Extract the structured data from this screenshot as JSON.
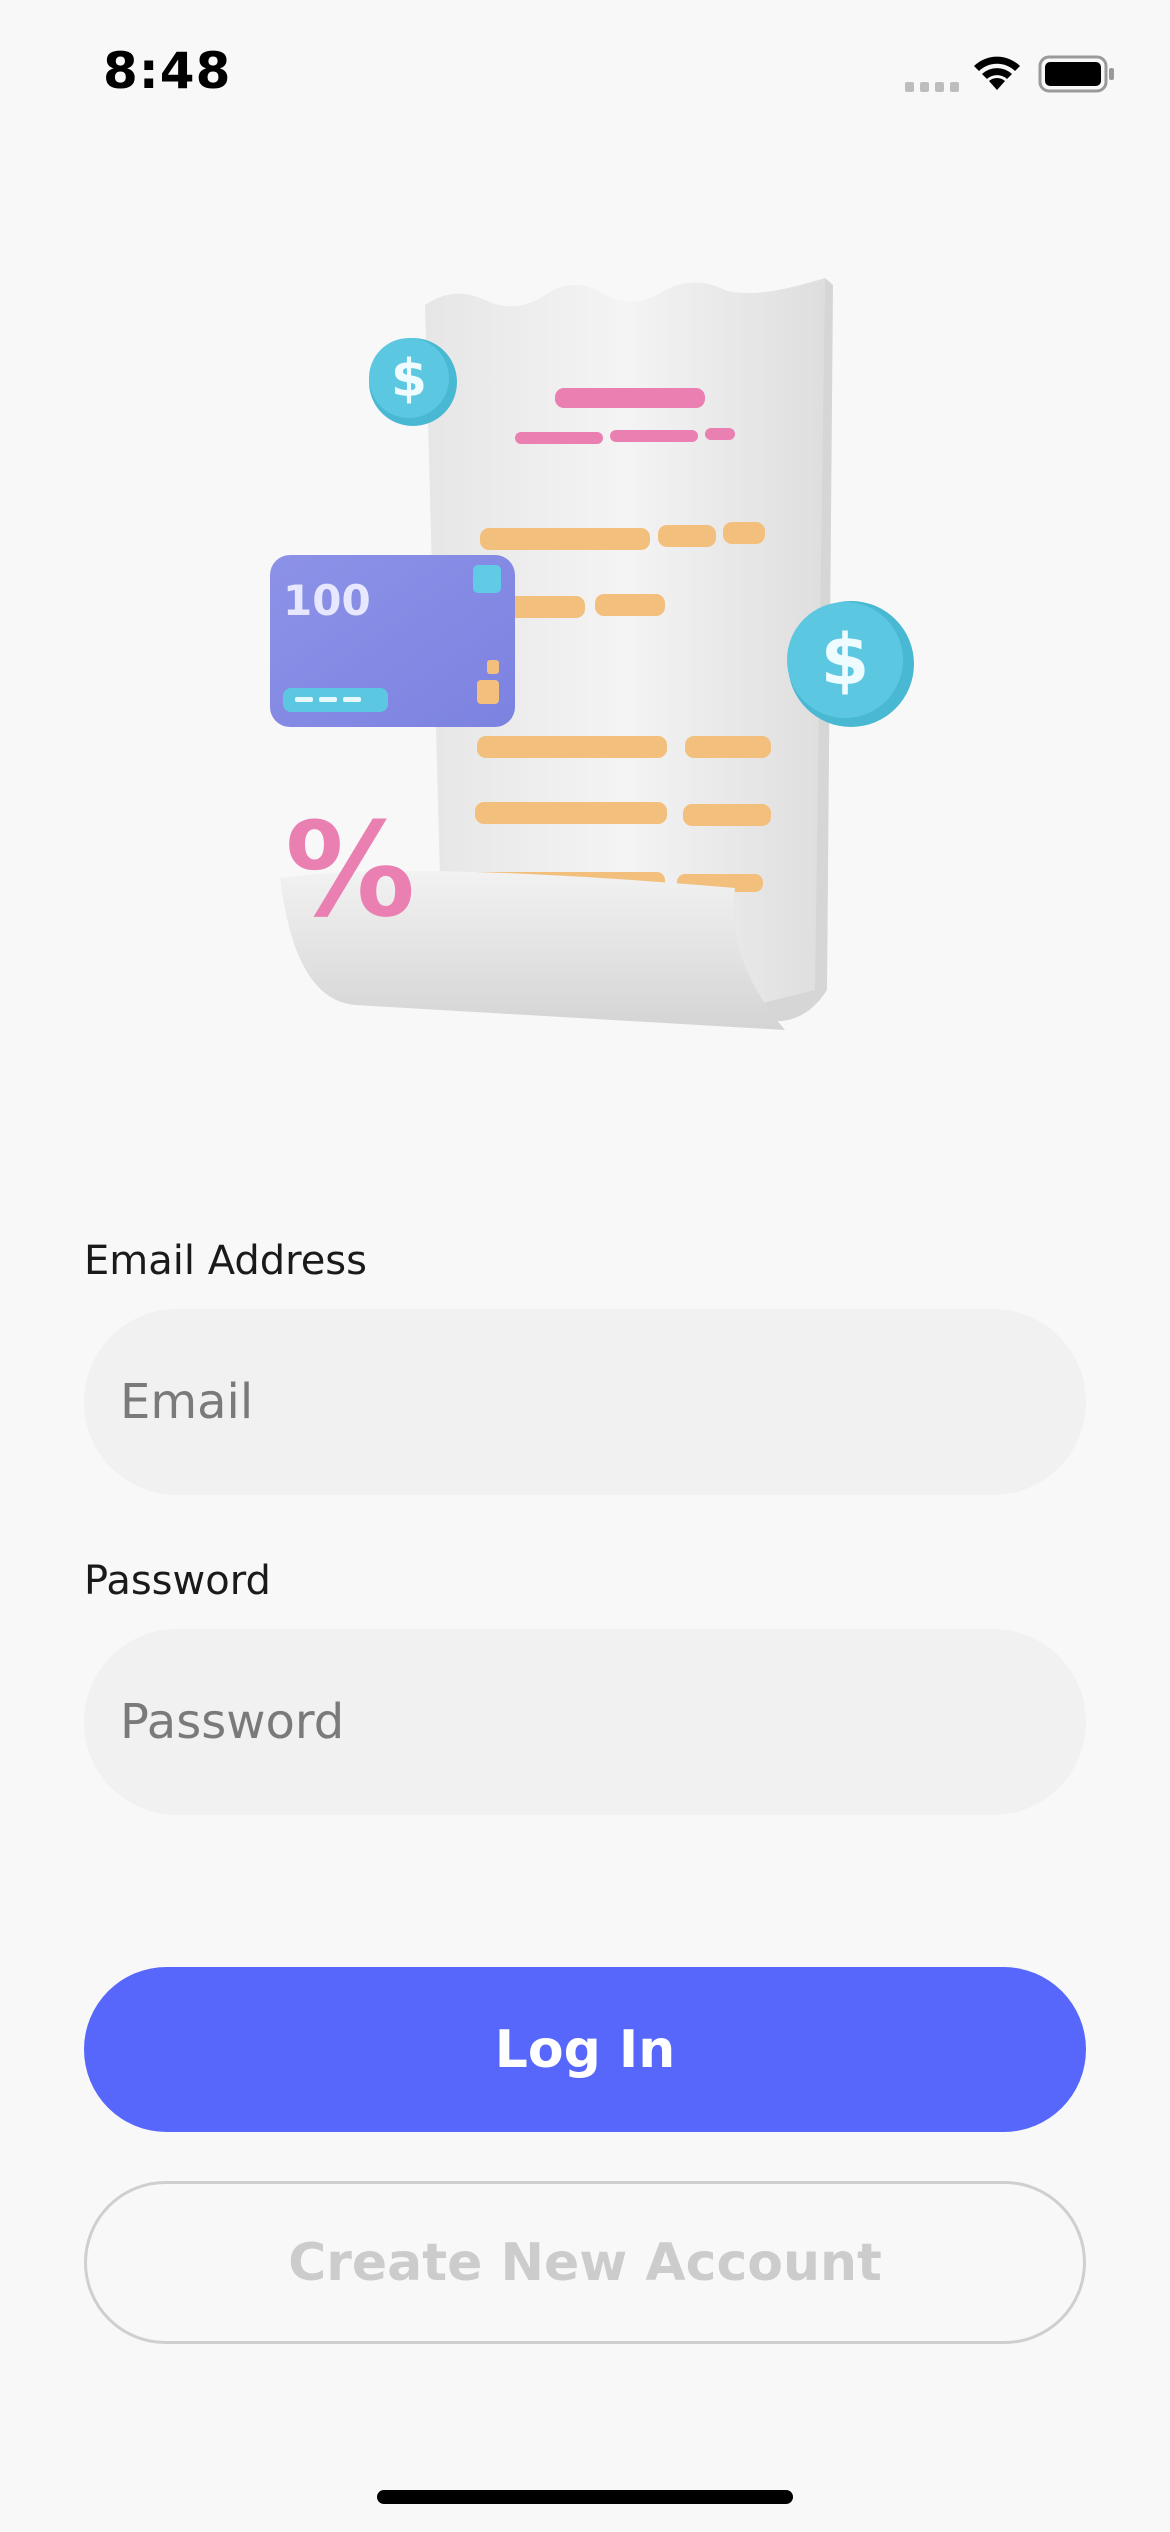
{
  "status_bar": {
    "time": "8:48",
    "icons": [
      "cellular-signal-icon",
      "wifi-icon",
      "battery-icon"
    ]
  },
  "hero": {
    "illustration": "receipt-illustration",
    "card_text": "100",
    "coin_symbol": "$",
    "percent_symbol": "%"
  },
  "form": {
    "email_label": "Email Address",
    "email_placeholder": "Email",
    "email_value": "",
    "password_label": "Password",
    "password_placeholder": "Password",
    "password_value": ""
  },
  "actions": {
    "login_label": "Log In",
    "create_account_label": "Create New Account"
  },
  "colors": {
    "background": "#f8f8f8",
    "primary": "#5767fb",
    "input_bg": "#f1f1f1",
    "secondary_text": "#cccccc",
    "card": "#8a8fe6",
    "coin": "#5cc7e0",
    "accent_pink": "#ea7fb2",
    "accent_orange": "#f2c07c"
  }
}
